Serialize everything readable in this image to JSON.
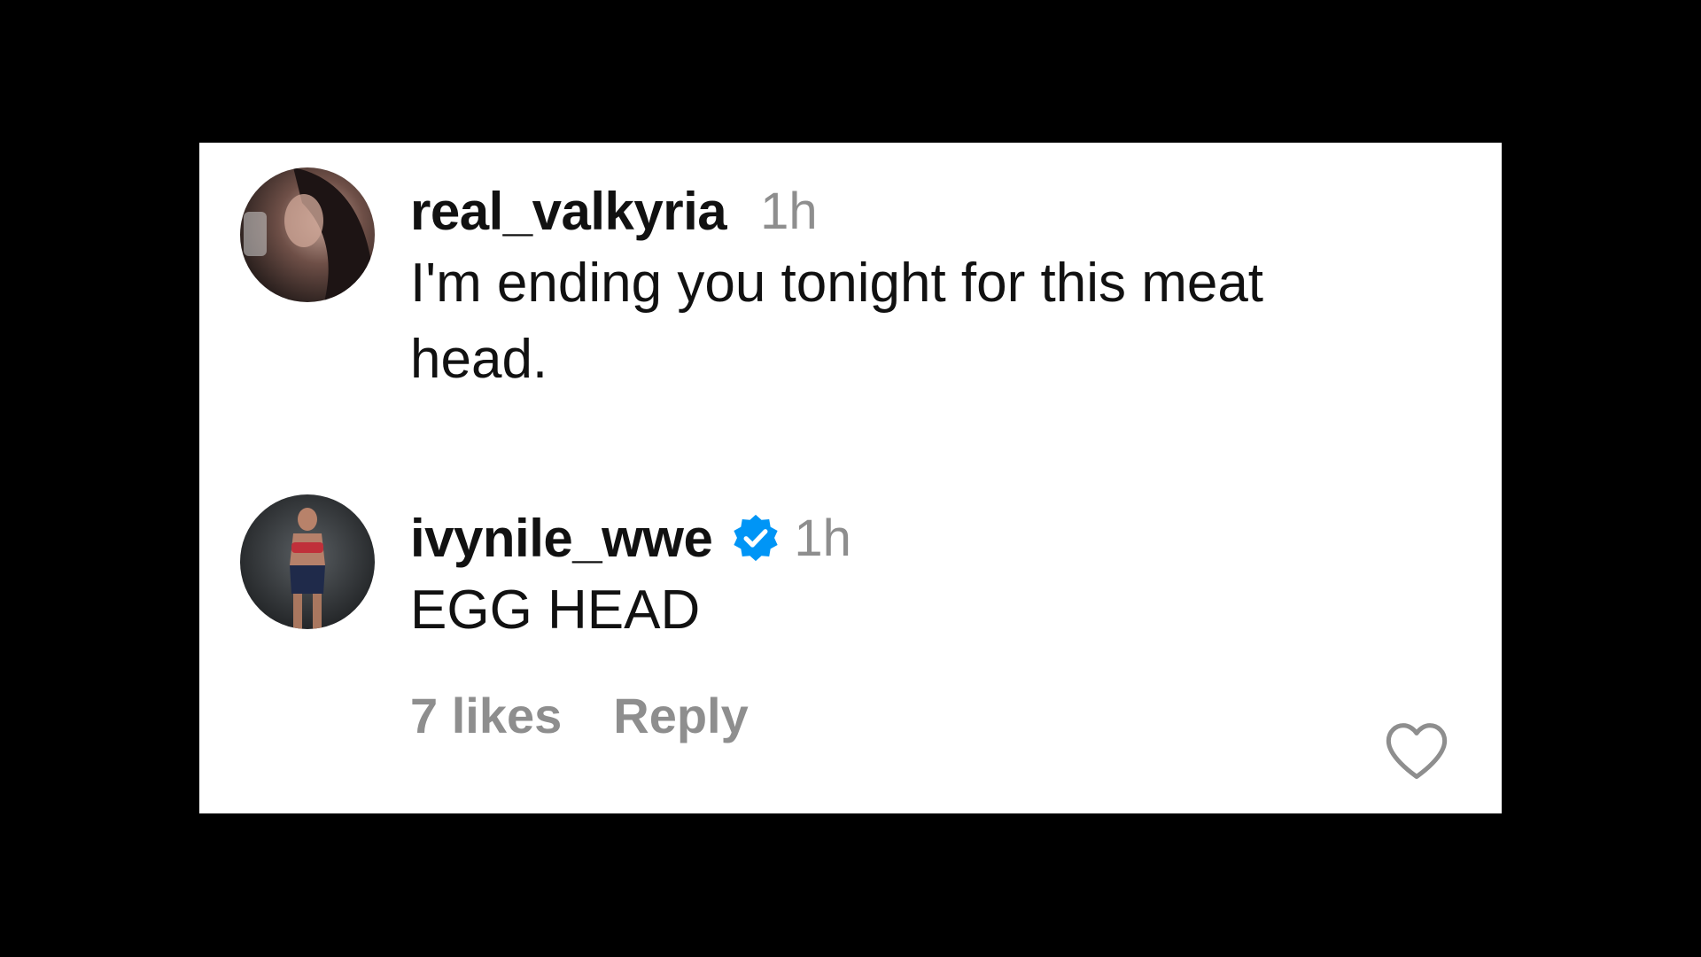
{
  "comments": [
    {
      "username": "real_valkyria",
      "time": "1h",
      "text": "I'm ending you tonight for this meat head.",
      "verified": false,
      "avatar_icon": "profile-photo"
    },
    {
      "username": "ivynile_wwe",
      "time": "1h",
      "text": "EGG HEAD",
      "verified": true,
      "likes": "7 likes",
      "reply_label": "Reply",
      "avatar_icon": "profile-photo",
      "like_icon": "heart-outline-icon"
    }
  ],
  "colors": {
    "background": "#000000",
    "card": "#ffffff",
    "text": "#111111",
    "muted": "#8e8e8e",
    "verified": "#0095f6"
  }
}
